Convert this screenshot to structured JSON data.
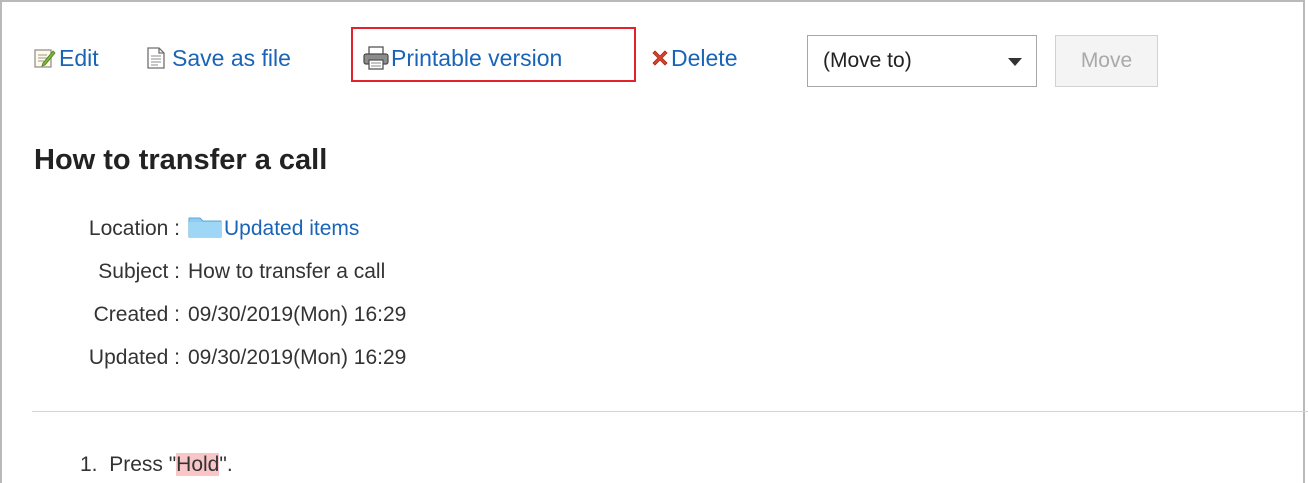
{
  "toolbar": {
    "edit_label": "Edit",
    "edit_icon": "edit-note-icon",
    "save_label": "Save as file",
    "save_icon": "document-icon",
    "print_label": "Printable version",
    "print_icon": "printer-icon",
    "delete_label": "Delete",
    "delete_icon": "red-x-icon",
    "highlight_color": "#e2222b"
  },
  "move": {
    "select_value": "(Move to)",
    "button_label": "Move"
  },
  "article": {
    "title": "How to transfer a call",
    "meta": {
      "location_key": "Location :",
      "location_value": "Updated items",
      "location_icon": "folder-icon",
      "subject_key": "Subject :",
      "subject_value": "How to transfer a call",
      "created_key": "Created :",
      "created_value": "09/30/2019(Mon) 16:29",
      "updated_key": "Updated :",
      "updated_value": "09/30/2019(Mon) 16:29"
    },
    "steps": [
      {
        "number": "1.",
        "before": "Press \"",
        "highlight": "Hold",
        "after": "\"."
      }
    ]
  },
  "colors": {
    "link": "#1a64b8",
    "highlight_bg": "#f8c6c6",
    "frame_border": "#b9b9b9"
  }
}
